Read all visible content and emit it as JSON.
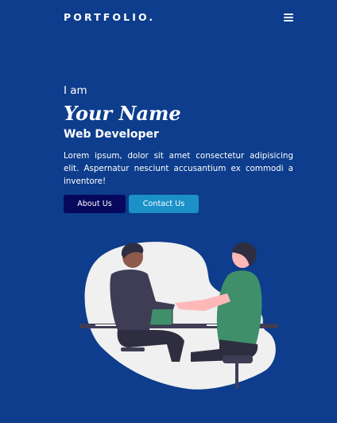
{
  "navbar": {
    "brand": "PORTFOLIO.",
    "menu_icon": "hamburger-menu-icon"
  },
  "hero": {
    "greeting": "I am",
    "name": "Your Name",
    "role": "Web Developer",
    "intro": "Lorem ipsum, dolor sit amet consectetur adipisicing elit. Aspernatur nesciunt accusantium ex commodi a inventore!",
    "about_label": "About Us",
    "contact_label": "Contact Us"
  },
  "colors": {
    "background": "#0d3d8c",
    "about_button": "#06085c",
    "contact_button": "#1b90c9",
    "illustration_blob": "#f0f0f0"
  }
}
